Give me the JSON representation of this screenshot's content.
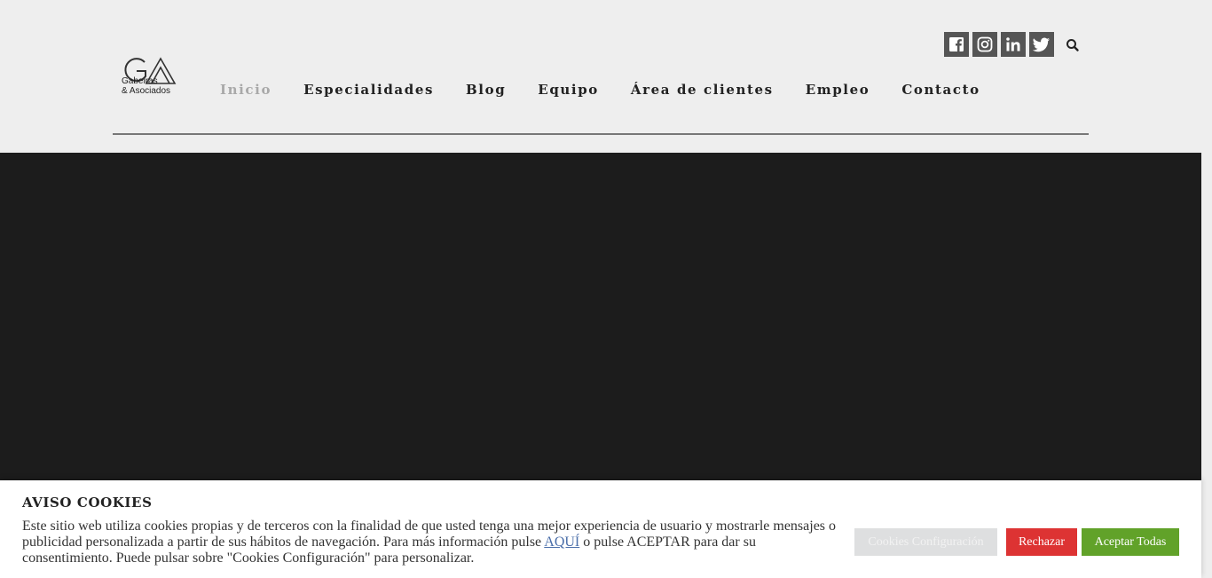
{
  "logo": {
    "line1": "Gabeiras",
    "line2": "& Asociados"
  },
  "nav": {
    "items": [
      {
        "label": "Inicio",
        "active": true
      },
      {
        "label": "Especialidades",
        "active": false
      },
      {
        "label": "Blog",
        "active": false
      },
      {
        "label": "Equipo",
        "active": false
      },
      {
        "label": "Área de clientes",
        "active": false
      },
      {
        "label": "Empleo",
        "active": false
      },
      {
        "label": "Contacto",
        "active": false
      }
    ]
  },
  "social": {
    "icons": [
      "facebook-icon",
      "instagram-icon",
      "linkedin-icon",
      "twitter-icon"
    ],
    "search_icon": "search-icon"
  },
  "cookie": {
    "title": "AVISO COOKIES",
    "text_before": "Este sitio web utiliza cookies propias y de terceros con la finalidad de que usted tenga una mejor experiencia de usuario y mostrarle mensajes o publicidad personalizada a partir de sus hábitos de navegación. Para más información pulse ",
    "link": "AQUÍ",
    "text_after": " o pulse ACEPTAR para dar su consentimiento. Puede pulsar sobre \"Cookies Configuración\" para personalizar.",
    "config_button": "Cookies Configuración",
    "reject_button": "Rechazar",
    "accept_button": "Aceptar Todas"
  },
  "colors": {
    "hero_bg": "#1c1c1c",
    "reject": "#dd3333",
    "accept": "#61a229"
  }
}
